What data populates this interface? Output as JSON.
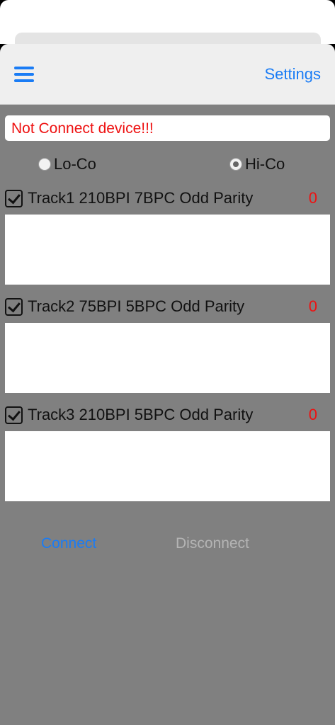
{
  "nav": {
    "menu_icon": "hamburger-menu-icon",
    "settings_label": "Settings"
  },
  "status": {
    "message": "Not Connect device!!!"
  },
  "coercivity": {
    "options": [
      {
        "label": "Lo-Co",
        "selected": false
      },
      {
        "label": "Hi-Co",
        "selected": true
      }
    ]
  },
  "tracks": [
    {
      "label": "Track1  210BPI 7BPC Odd Parity",
      "count": "0",
      "checked": true,
      "data": ""
    },
    {
      "label": "Track2  75BPI 5BPC Odd Parity",
      "count": "0",
      "checked": true,
      "data": ""
    },
    {
      "label": "Track3  210BPI 5BPC Odd Parity",
      "count": "0",
      "checked": true,
      "data": ""
    }
  ],
  "actions": {
    "connect_label": "Connect",
    "disconnect_label": "Disconnect"
  },
  "colors": {
    "accent": "#1a7cf5",
    "error": "#ee1111",
    "background": "#808080",
    "disabled": "#b4b4b4"
  }
}
